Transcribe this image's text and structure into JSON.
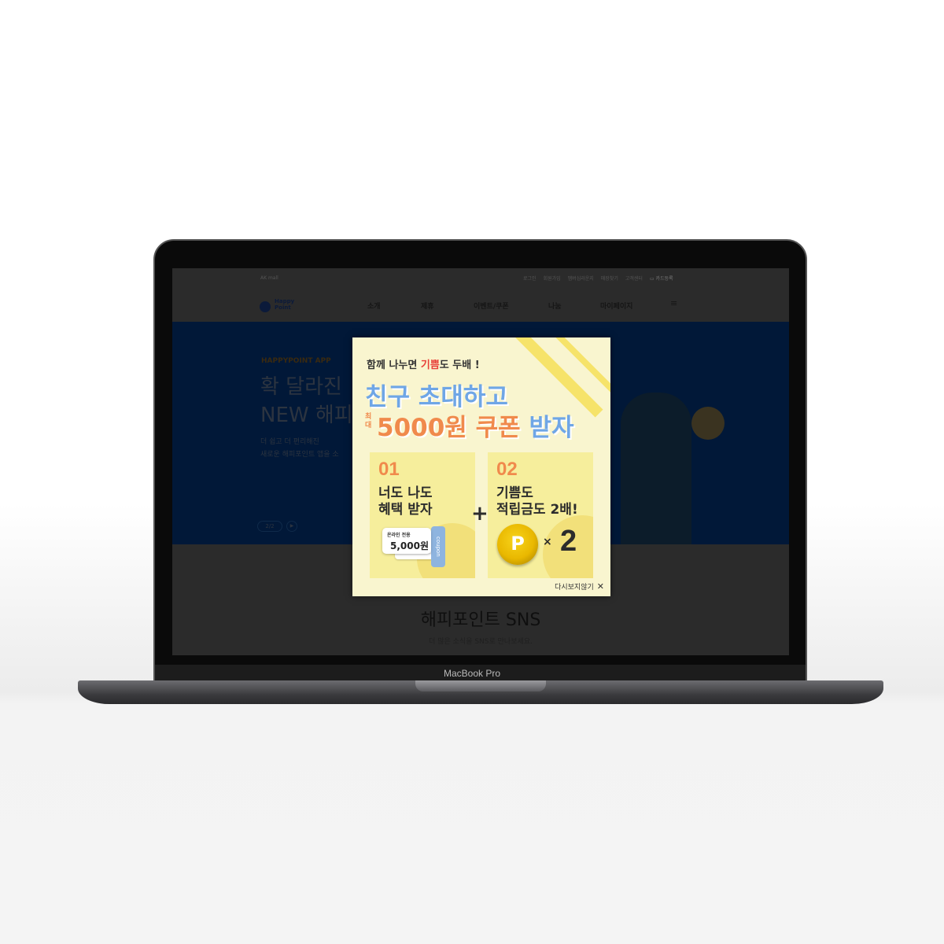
{
  "site": {
    "top_left": "AK mall",
    "util_links": [
      "로그인",
      "회원가입",
      "멤버십라운지",
      "매장찾기",
      "고객센터"
    ],
    "card_register": "카드등록",
    "logo": "Happy Point",
    "nav": [
      "소개",
      "제휴",
      "이벤트/쿠폰",
      "나눔",
      "마이페이지"
    ],
    "banner": {
      "eyebrow": "HAPPYPOINT APP",
      "title1": "확 달라진",
      "title2": "NEW 해피",
      "desc1": "더 쉽고 더 편리해진",
      "desc2": "새로운 해피포인트 앱을 소",
      "pager": "2/2"
    },
    "sns": {
      "title": "해피포인트 SNS",
      "desc": "더 많은 소식을 SNS로 만나보세요."
    }
  },
  "popup": {
    "subtitle_pre": "함께 나누면 ",
    "subtitle_hl": "기쁨",
    "subtitle_post": "도 두배 !",
    "headline1": "친구 초대하고",
    "max_label": "최대",
    "headline2_amount": "5000원 쿠폰",
    "headline2_end": "받자",
    "card1": {
      "num": "01",
      "line1": "너도 나도",
      "line2": "혜택 받자",
      "coupon_label": "온라인 전용",
      "coupon_value": "5,000원",
      "coupon_tab": "coupon"
    },
    "card2": {
      "num": "02",
      "line1": "기쁨도",
      "line2": "적립금도 2배!",
      "coin": "P",
      "mult": "×",
      "two": "2"
    },
    "plus": "+",
    "dont_show": "다시보지않기",
    "close": "✕"
  },
  "device_label": "MacBook Pro",
  "colors": {
    "accent_orange": "#f08a4c",
    "accent_blue": "#6fa6e6",
    "highlight_red": "#e8413a"
  }
}
